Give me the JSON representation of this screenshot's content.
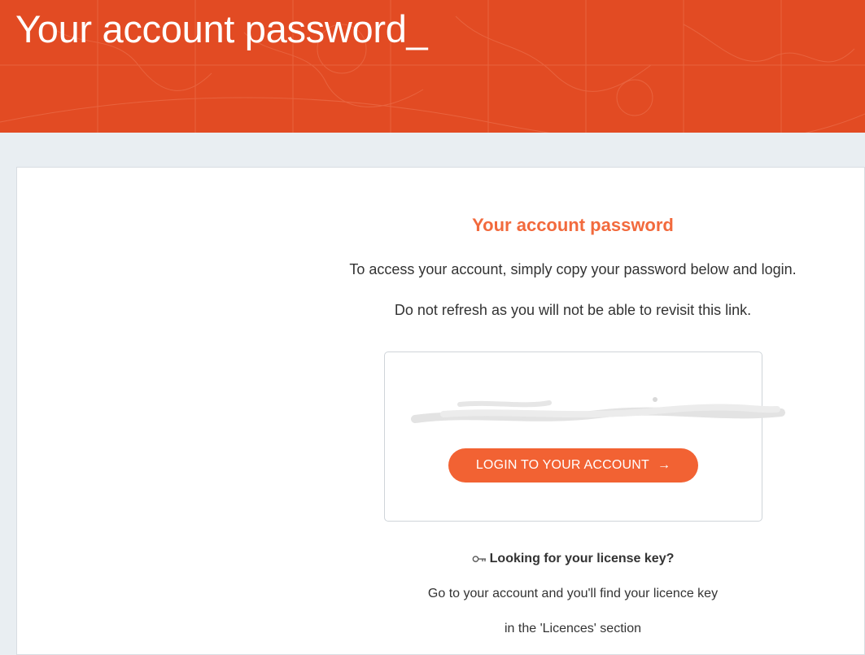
{
  "header": {
    "title": "Your account password_",
    "background_color": "#e24b23"
  },
  "card": {
    "title": "Your account password",
    "instruction_1": "To access your account, simply copy your password below and login.",
    "instruction_2": "Do not refresh as you will not be able to revisit this link.",
    "password_box": {
      "password_value_note": "redacted",
      "login_button_label": "LOGIN TO YOUR ACCOUNT",
      "login_button_icon": "arrow-right-icon"
    },
    "license": {
      "icon": "key-icon",
      "heading": "Looking for your license key?",
      "line_1": "Go to your account and you'll find your licence key",
      "line_2": "in the 'Licences' section"
    }
  },
  "colors": {
    "accent": "#f26233",
    "title_accent": "#f26a3d",
    "page_background": "#e9eef2"
  }
}
